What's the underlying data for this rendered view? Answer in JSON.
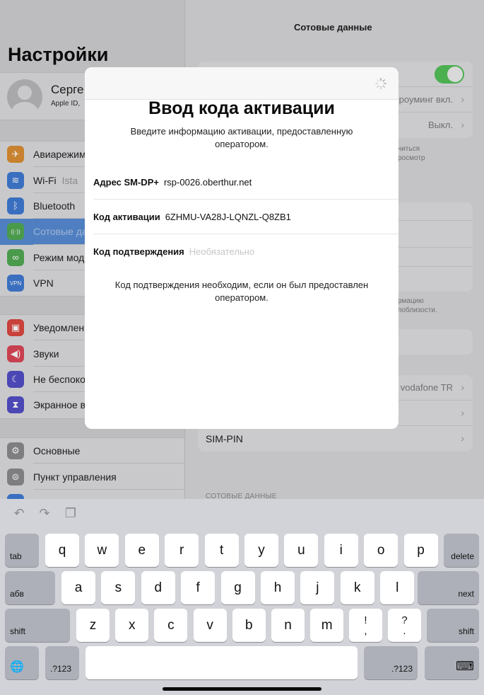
{
  "sidebar": {
    "title": "Настройки",
    "profile": {
      "name": "Серге",
      "subtitle": "Apple ID,"
    },
    "groups": [
      [
        {
          "label": "Авиарежим",
          "icon": "airplane-icon",
          "color": "#c8812e",
          "glyph": "✈"
        },
        {
          "label": "Wi-Fi",
          "value": "Ista",
          "icon": "wifi-icon",
          "color": "#3a6fc0",
          "glyph": "≋"
        },
        {
          "label": "Bluetooth",
          "icon": "bluetooth-icon",
          "color": "#3a6fc0",
          "glyph": "ᛒ"
        },
        {
          "label": "Сотовые да",
          "icon": "cellular-icon",
          "color": "#4a9a4c",
          "glyph": "((·))",
          "selected": true
        },
        {
          "label": "Режим мод",
          "icon": "hotspot-icon",
          "color": "#4a9a4c",
          "glyph": "∞"
        },
        {
          "label": "VPN",
          "icon": "vpn-icon",
          "color": "#3a6fc0",
          "glyph": "VPN"
        }
      ],
      [
        {
          "label": "Уведомлен",
          "icon": "notifications-icon",
          "color": "#c8413a",
          "glyph": "▣"
        },
        {
          "label": "Звуки",
          "icon": "sounds-icon",
          "color": "#c8404f",
          "glyph": "◀)"
        },
        {
          "label": "Не беспоко",
          "icon": "moon-icon",
          "color": "#4b47b5",
          "glyph": "☾"
        },
        {
          "label": "Экранное в",
          "icon": "hourglass-icon",
          "color": "#4b47b5",
          "glyph": "⧗"
        }
      ],
      [
        {
          "label": "Основные",
          "icon": "gear-icon",
          "color": "#7e7e80",
          "glyph": "⚙"
        },
        {
          "label": "Пункт управления",
          "icon": "control-center-icon",
          "color": "#7e7e80",
          "glyph": "⊜"
        },
        {
          "label": "",
          "icon": "display-icon",
          "color": "#3a6fc0",
          "glyph": ""
        }
      ]
    ]
  },
  "detail": {
    "title": "Сотовые данные",
    "card1": {
      "roaming_value": "роуминг вкл.",
      "off_value": "Выкл."
    },
    "note1": [
      "читься",
      "росмотр"
    ],
    "note2": [
      "рмацию",
      "поблизости."
    ],
    "card4": {
      "carrier_value": "vodafone TR",
      "sim_pin_label": "SIM-PIN"
    },
    "section_header": "СОТОВЫЕ ДАННЫЕ"
  },
  "modal": {
    "title": "Ввод кода активации",
    "subtitle": "Введите информацию активации, предоставленную оператором.",
    "fields": [
      {
        "label": "Адрес SM-DP+",
        "value": "rsp-0026.oberthur.net",
        "placeholder": ""
      },
      {
        "label": "Код активации",
        "value": "6ZHMU-VA28J-LQNZL-Q8ZB1",
        "placeholder": ""
      },
      {
        "label": "Код подтверждения",
        "value": "",
        "placeholder": "Необязательно"
      }
    ],
    "footnote": "Код подтверждения необходим, если он был предоставлен оператором."
  },
  "keyboard": {
    "toolbar": {
      "undo": "↶",
      "redo": "↷",
      "paste": "❐"
    },
    "row1": [
      "q",
      "w",
      "e",
      "r",
      "t",
      "y",
      "u",
      "i",
      "o",
      "p"
    ],
    "row2": [
      "a",
      "s",
      "d",
      "f",
      "g",
      "h",
      "j",
      "k",
      "l"
    ],
    "row3": [
      "z",
      "x",
      "c",
      "v",
      "b",
      "n",
      "m"
    ],
    "punct1": {
      "top": "!",
      "bottom": ","
    },
    "punct2": {
      "top": "?",
      "bottom": "."
    },
    "tab": "tab",
    "delete": "delete",
    "lang": "абв",
    "next": "next",
    "shift": "shift",
    "numbers": ".?123",
    "globe": "🌐",
    "dismiss": "⌨"
  }
}
